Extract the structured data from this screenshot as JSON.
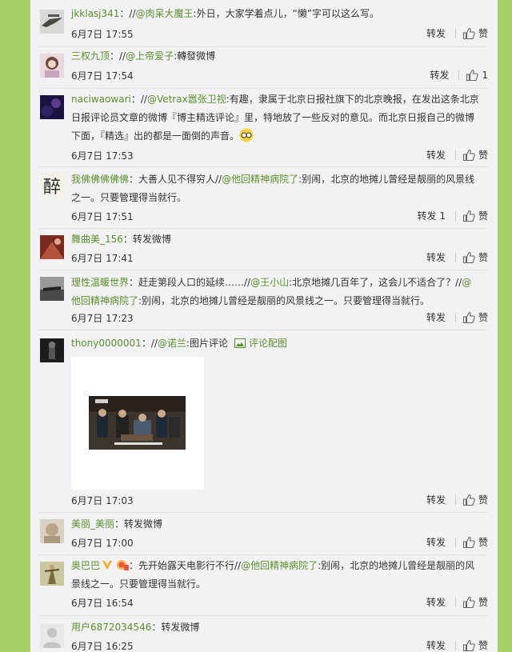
{
  "action_labels": {
    "forward": "转发",
    "like": "赞"
  },
  "comments": [
    {
      "user": "jkklasj341",
      "sep": "：//",
      "mention": "@肉呆大魔王",
      "text": ":外日，大家学着点儿，“懒”字可以这么写。",
      "time": "6月7日 17:55",
      "forward": "转发",
      "like": "赞"
    },
    {
      "user": "三权九顶",
      "sep": "：//",
      "mention": "@上帝爱子",
      "text": ":轉發微博",
      "time": "6月7日 17:54",
      "forward": "转发",
      "like_count": "1"
    },
    {
      "user": "naciwaowari",
      "sep": "：//",
      "mention": "@Vetrax嚣张卫视",
      "text": ":有趣，隶属于北京日报社旗下的北京晚报，在发出这条北京日报评论员文章的微博『博主精选评论』里，特地放了一些反对的意见。而北京日报自己的微博下面，『精选』出的都是一面倒的声音。",
      "time": "6月7日 17:53",
      "forward": "转发",
      "like": "赞"
    },
    {
      "user": "我佛佛佛佛佛",
      "text1": "：大善人见不得穷人//",
      "mention": "@他回精神病院了",
      "text": ":别闹，北京的地摊儿曾经是靓丽的风景线之一。只要管理得当就行。",
      "time": "6月7日 17:51",
      "forward": "转发 1",
      "like": "赞"
    },
    {
      "user": "舞曲美_156",
      "text": "：转发微博",
      "time": "6月7日 17:41",
      "forward": "转发",
      "like": "赞"
    },
    {
      "user": "理性温暖世界",
      "text1": "：赶走第段人口的延续……//",
      "mention": "@王小山",
      "text2": ":北京地摊几百年了，这会儿不适合了？//",
      "mention2": "@他回精神病院了",
      "text": ":别闹，北京的地摊儿曾经是靓丽的风景线之一。只要管理得当就行。",
      "time": "6月7日 17:23",
      "forward": "转发",
      "like": "赞"
    },
    {
      "user": "thony0000001",
      "sep": "：//",
      "mention": "@诺兰",
      "text": ":图片评论",
      "pic_label": "评论配图",
      "time": "6月7日 17:03",
      "forward": "转发",
      "like": "赞"
    },
    {
      "user": "美丽_美丽",
      "text": "：转发微博",
      "time": "6月7日 17:00",
      "forward": "转发",
      "like": "赞"
    },
    {
      "user": "奥巴巴",
      "text1": "：先开始露天电影行不行//",
      "mention": "@他回精神病院了",
      "text": ":别闹，北京的地摊儿曾经是靓丽的风景线之一。只要管理得当就行。",
      "time": "6月7日 16:54",
      "forward": "转发",
      "like": "赞"
    },
    {
      "user": "用户6872034546",
      "text": "：转发微博",
      "time": "6月7日 16:25",
      "forward": "转发",
      "like": "赞"
    }
  ],
  "colors": {
    "page_bg": "#a6cf6a",
    "panel_bg": "#f2f2f5",
    "link": "#5a8f2a"
  },
  "icons": [
    "thumb-up-icon",
    "picture-icon",
    "glasses-emoji-icon",
    "verified-v-icon",
    "vip-badge-icon"
  ]
}
